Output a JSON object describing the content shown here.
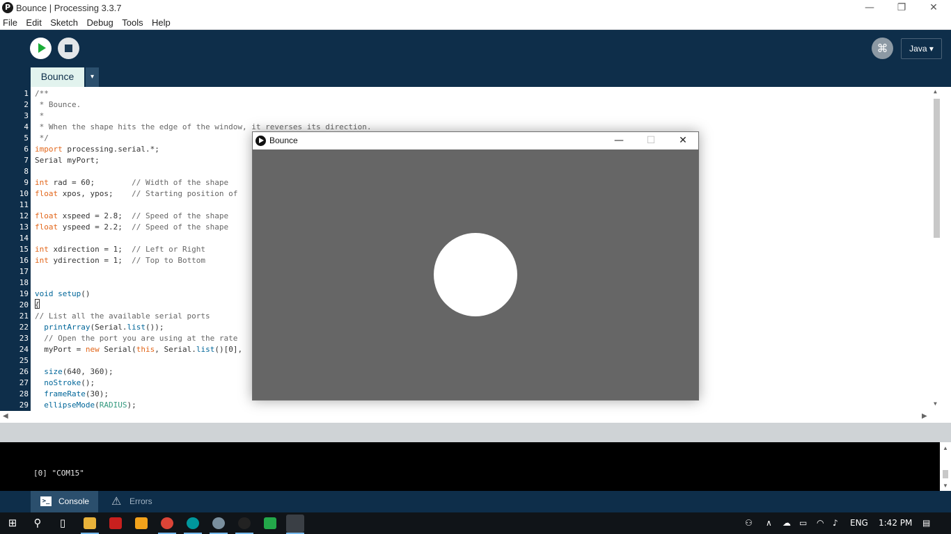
{
  "window": {
    "app_icon_letter": "P",
    "title": "Bounce | Processing 3.3.7",
    "controls": {
      "minimize": "—",
      "restore": "❐",
      "close": "✕"
    }
  },
  "menu": [
    "File",
    "Edit",
    "Sketch",
    "Debug",
    "Tools",
    "Help"
  ],
  "toolbar": {
    "run_icon": "play-icon",
    "stop_icon": "stop-icon",
    "debug_icon": "butterfly-icon",
    "mode_label": "Java ▾"
  },
  "tabs": {
    "active": "Bounce",
    "menu_glyph": "▾"
  },
  "editor": {
    "line_numbers": [
      "1",
      "2",
      "3",
      "4",
      "5",
      "6",
      "7",
      "8",
      "9",
      "10",
      "11",
      "12",
      "13",
      "14",
      "15",
      "16",
      "17",
      "18",
      "19",
      "20",
      "21",
      "22",
      "23",
      "24",
      "25",
      "26",
      "27",
      "28",
      "29"
    ],
    "lines": [
      {
        "t": "/**",
        "c": "cm"
      },
      {
        "t": " * Bounce.",
        "c": "cm"
      },
      {
        "t": " *",
        "c": "cm"
      },
      {
        "t": " * When the shape hits the edge of the window, it reverses its direction.",
        "c": "cm"
      },
      {
        "t": " */",
        "c": "cm"
      },
      {
        "parts": [
          {
            "t": "import",
            "c": "kw"
          },
          {
            "t": " processing.serial.*;",
            "c": ""
          }
        ]
      },
      {
        "parts": [
          {
            "t": "Serial myPort;",
            "c": ""
          }
        ]
      },
      {
        "t": "",
        "c": ""
      },
      {
        "parts": [
          {
            "t": "int",
            "c": "kw"
          },
          {
            "t": " rad = 60;        ",
            "c": ""
          },
          {
            "t": "// Width of the shape",
            "c": "cm"
          }
        ]
      },
      {
        "parts": [
          {
            "t": "float",
            "c": "kw"
          },
          {
            "t": " xpos, ypos;    ",
            "c": ""
          },
          {
            "t": "// Starting position of",
            "c": "cm"
          }
        ]
      },
      {
        "t": "",
        "c": ""
      },
      {
        "parts": [
          {
            "t": "float",
            "c": "kw"
          },
          {
            "t": " xspeed = 2.8;  ",
            "c": ""
          },
          {
            "t": "// Speed of the shape",
            "c": "cm"
          }
        ]
      },
      {
        "parts": [
          {
            "t": "float",
            "c": "kw"
          },
          {
            "t": " yspeed = 2.2;  ",
            "c": ""
          },
          {
            "t": "// Speed of the shape",
            "c": "cm"
          }
        ]
      },
      {
        "t": "",
        "c": ""
      },
      {
        "parts": [
          {
            "t": "int",
            "c": "kw"
          },
          {
            "t": " xdirection = 1;  ",
            "c": ""
          },
          {
            "t": "// Left or Right",
            "c": "cm"
          }
        ]
      },
      {
        "parts": [
          {
            "t": "int",
            "c": "kw"
          },
          {
            "t": " ydirection = 1;  ",
            "c": ""
          },
          {
            "t": "// Top to Bottom",
            "c": "cm"
          }
        ]
      },
      {
        "t": "",
        "c": ""
      },
      {
        "t": "",
        "c": ""
      },
      {
        "parts": [
          {
            "t": "void",
            "c": "fn"
          },
          {
            "t": " ",
            "c": ""
          },
          {
            "t": "setup",
            "c": "fn"
          },
          {
            "t": "()",
            "c": ""
          }
        ]
      },
      {
        "parts": [
          {
            "t": "{",
            "c": ""
          }
        ]
      },
      {
        "parts": [
          {
            "t": "// List all the available serial ports",
            "c": "cm"
          }
        ]
      },
      {
        "parts": [
          {
            "t": "  ",
            "c": ""
          },
          {
            "t": "printArray",
            "c": "fn"
          },
          {
            "t": "(Serial.",
            "c": ""
          },
          {
            "t": "list",
            "c": "fn"
          },
          {
            "t": "());",
            "c": ""
          }
        ]
      },
      {
        "parts": [
          {
            "t": "  // Open the port you are using at the rate",
            "c": "cm"
          }
        ]
      },
      {
        "parts": [
          {
            "t": "  myPort = ",
            "c": ""
          },
          {
            "t": "new",
            "c": "kw"
          },
          {
            "t": " Serial(",
            "c": ""
          },
          {
            "t": "this",
            "c": "kw"
          },
          {
            "t": ", Serial.",
            "c": ""
          },
          {
            "t": "list",
            "c": "fn"
          },
          {
            "t": "()[0],",
            "c": ""
          }
        ]
      },
      {
        "t": "",
        "c": ""
      },
      {
        "parts": [
          {
            "t": "  ",
            "c": ""
          },
          {
            "t": "size",
            "c": "fn"
          },
          {
            "t": "(640, 360);",
            "c": ""
          }
        ]
      },
      {
        "parts": [
          {
            "t": "  ",
            "c": ""
          },
          {
            "t": "noStroke",
            "c": "fn"
          },
          {
            "t": "();",
            "c": ""
          }
        ]
      },
      {
        "parts": [
          {
            "t": "  ",
            "c": ""
          },
          {
            "t": "frameRate",
            "c": "fn"
          },
          {
            "t": "(30);",
            "c": ""
          }
        ]
      },
      {
        "parts": [
          {
            "t": "  ",
            "c": ""
          },
          {
            "t": "ellipseMode",
            "c": "fn"
          },
          {
            "t": "(",
            "c": ""
          },
          {
            "t": "RADIUS",
            "c": "bl"
          },
          {
            "t": ");",
            "c": ""
          }
        ]
      }
    ]
  },
  "console": {
    "output": "[0] \"COM15\"",
    "tabs": {
      "console": "Console",
      "errors": "Errors"
    }
  },
  "sketch_window": {
    "title": "Bounce",
    "controls": {
      "minimize": "—",
      "maximize": "☐",
      "close": "✕"
    },
    "background": "#666666",
    "shape_color": "#ffffff"
  },
  "taskbar": {
    "language": "ENG",
    "time": "1:42 PM"
  },
  "colors": {
    "toolbar_bg": "#0e2e4a",
    "run_green": "#1aad38",
    "keyword": "#e2661a",
    "function": "#006699"
  }
}
